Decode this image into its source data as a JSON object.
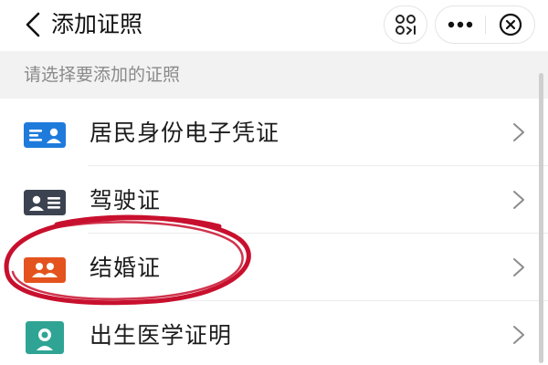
{
  "header": {
    "title": "添加证照",
    "icons": {
      "back": "chevron-left-icon",
      "scan": "scan-code-icon",
      "more": "more-dots-icon",
      "close": "close-circle-icon"
    }
  },
  "subtitle": "请选择要添加的证照",
  "certificates": [
    {
      "label": "居民身份电子凭证",
      "icon": "id-card-icon",
      "color": "#1e7bdc"
    },
    {
      "label": "驾驶证",
      "icon": "driver-license-icon",
      "color": "#3c4350"
    },
    {
      "label": "结婚证",
      "icon": "marriage-certificate-icon",
      "color": "#e4531e"
    },
    {
      "label": "出生医学证明",
      "icon": "birth-certificate-icon",
      "color": "#2fa494"
    }
  ],
  "colors": {
    "annotation_circle": "#c8102e",
    "subtitle_band": "#f2f2f2",
    "chevron": "#8c8c8c"
  }
}
